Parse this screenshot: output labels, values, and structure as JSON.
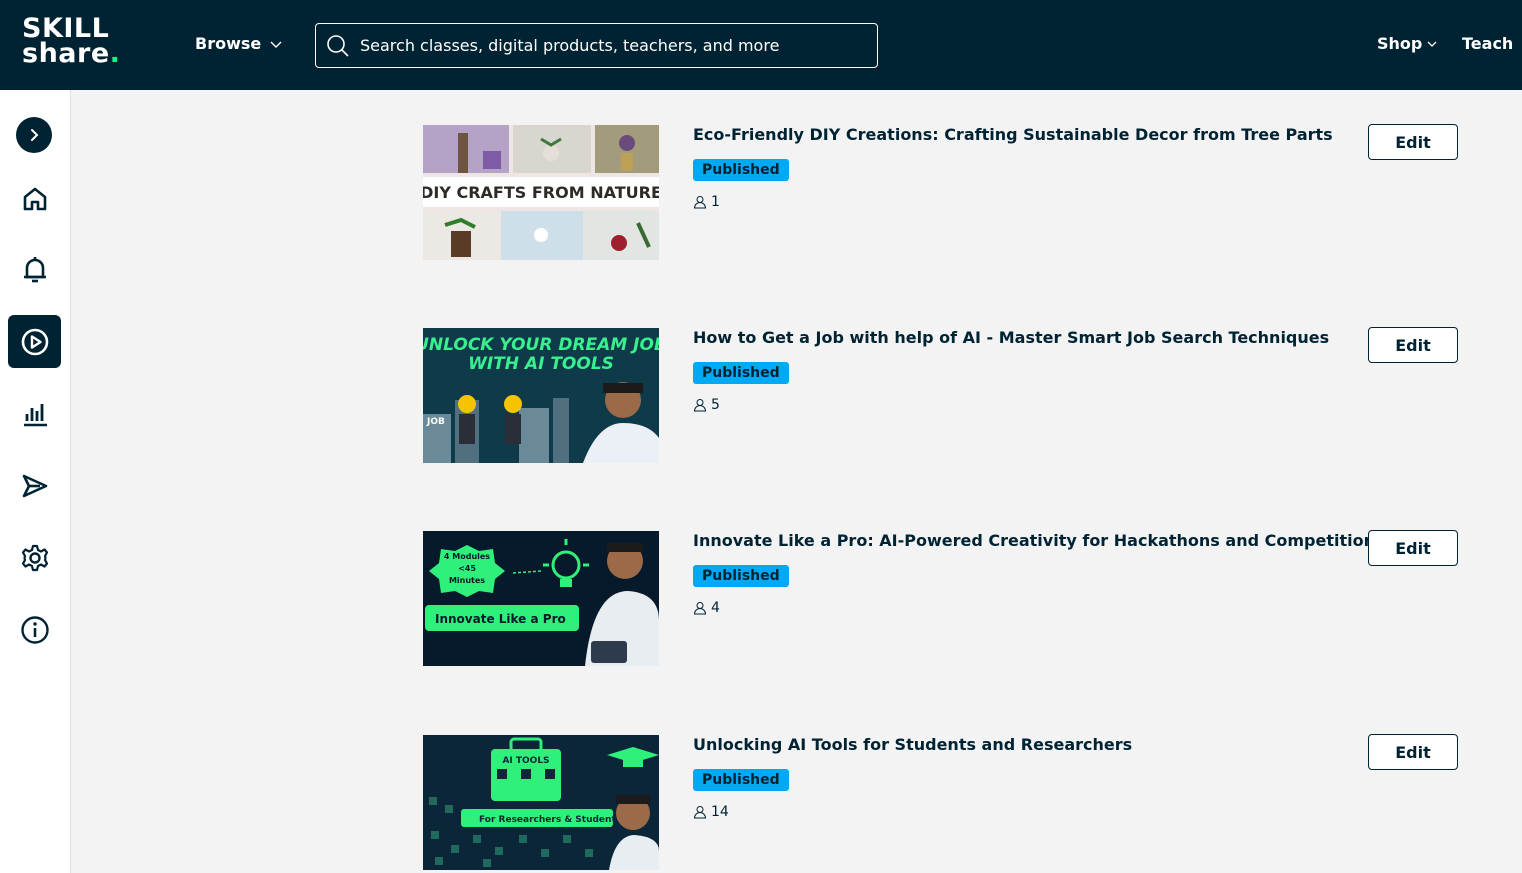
{
  "header": {
    "logo_line1": "SKILL",
    "logo_line2": "share",
    "logo_dot": ".",
    "browse_label": "Browse",
    "search_placeholder": "Search classes, digital products, teachers, and more",
    "shop_label": "Shop",
    "teach_label": "Teach"
  },
  "sidebar": {
    "items": [
      {
        "icon": "chevron-right-icon"
      },
      {
        "icon": "home-icon"
      },
      {
        "icon": "bell-icon"
      },
      {
        "icon": "play-circle-icon",
        "active": true
      },
      {
        "icon": "bar-chart-icon"
      },
      {
        "icon": "send-icon"
      },
      {
        "icon": "gear-icon"
      },
      {
        "icon": "info-icon"
      }
    ]
  },
  "colors": {
    "navy": "#002333",
    "accent_green": "#00ff84",
    "published_blue": "#00a9f4"
  },
  "classes": [
    {
      "title": "Eco-Friendly DIY Creations: Crafting Sustainable Decor from Tree Parts",
      "status": "Published",
      "students": "1",
      "edit_label": "Edit",
      "thumb_text": "DIY CRAFTS FROM NATURE"
    },
    {
      "title": "How to Get a Job with help of AI - Master Smart Job Search Techniques",
      "status": "Published",
      "students": "5",
      "edit_label": "Edit",
      "thumb_line1": "UNLOCK YOUR DREAM JOB",
      "thumb_line2": "WITH AI TOOLS",
      "thumb_sign": "JOB"
    },
    {
      "title": "Innovate Like a Pro: AI-Powered Creativity for Hackathons and Competitions",
      "status": "Published",
      "students": "4",
      "edit_label": "Edit",
      "thumb_badge1": "4 Modules",
      "thumb_badge2": "<45",
      "thumb_badge3": "Minutes",
      "thumb_banner": "Innovate Like a Pro"
    },
    {
      "title": "Unlocking AI Tools for Students and Researchers",
      "status": "Published",
      "students": "14",
      "edit_label": "Edit",
      "thumb_label": "AI TOOLS",
      "thumb_banner": "For Researchers & Students"
    }
  ]
}
